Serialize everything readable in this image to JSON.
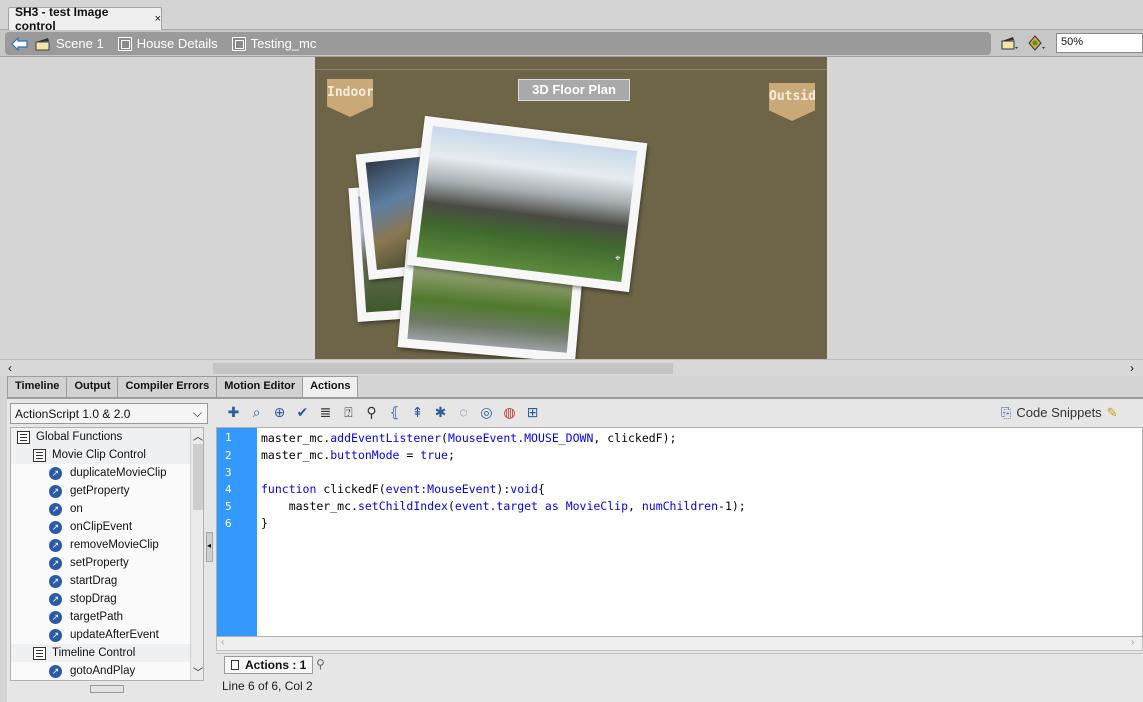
{
  "document_tab": {
    "title": "SH3 - test Image control",
    "close": "×"
  },
  "breadcrumbs": [
    {
      "label": "Scene 1"
    },
    {
      "label": "House Details"
    },
    {
      "label": "Testing_mc"
    }
  ],
  "zoom": {
    "value": "50%"
  },
  "stage": {
    "indoor_label": "Indoor",
    "outside_label": "Outside",
    "floor_plan_label": "3D Floor Plan"
  },
  "panel_tabs": [
    {
      "label": "Timeline"
    },
    {
      "label": "Output"
    },
    {
      "label": "Compiler Errors"
    },
    {
      "label": "Motion Editor"
    },
    {
      "label": "Actions"
    }
  ],
  "actions": {
    "language": "ActionScript 1.0 & 2.0",
    "code_snippets": "Code Snippets",
    "tree": [
      {
        "label": "Global Functions",
        "type": "folder",
        "level": 0
      },
      {
        "label": "Movie Clip Control",
        "type": "folder",
        "level": 1
      },
      {
        "label": "duplicateMovieClip",
        "type": "fn",
        "level": 2
      },
      {
        "label": "getProperty",
        "type": "fn",
        "level": 2
      },
      {
        "label": "on",
        "type": "fn",
        "level": 2
      },
      {
        "label": "onClipEvent",
        "type": "fn",
        "level": 2
      },
      {
        "label": "removeMovieClip",
        "type": "fn",
        "level": 2
      },
      {
        "label": "setProperty",
        "type": "fn",
        "level": 2
      },
      {
        "label": "startDrag",
        "type": "fn",
        "level": 2
      },
      {
        "label": "stopDrag",
        "type": "fn",
        "level": 2
      },
      {
        "label": "targetPath",
        "type": "fn",
        "level": 2
      },
      {
        "label": "updateAfterEvent",
        "type": "fn",
        "level": 2
      },
      {
        "label": "Timeline Control",
        "type": "folder",
        "level": 1
      },
      {
        "label": "gotoAndPlay",
        "type": "fn",
        "level": 2
      }
    ],
    "line_numbers": [
      "1",
      "2",
      "3",
      "4",
      "5",
      "6"
    ],
    "code": {
      "l1_a": "master_mc.",
      "l1_b": "addEventListener",
      "l1_c": "(",
      "l1_d": "MouseEvent.MOUSE_DOWN",
      "l1_e": ", clickedF);",
      "l2_a": "master_mc.",
      "l2_b": "buttonMode",
      "l2_c": " = ",
      "l2_d": "true",
      "l2_e": ";",
      "l4_a": "function",
      "l4_b": " clickedF(",
      "l4_c": "event:MouseEvent",
      "l4_d": "):",
      "l4_e": "void",
      "l4_f": "{",
      "l5_a": "    master_mc.",
      "l5_b": "setChildIndex",
      "l5_c": "(",
      "l5_d": "event.target",
      "l5_e": " as ",
      "l5_f": "MovieClip",
      "l5_g": ", ",
      "l5_h": "numChildren",
      "l5_i": "-1);",
      "l6": "}"
    },
    "script_tab": "Actions : 1",
    "status": "Line 6 of 6, Col 2"
  }
}
